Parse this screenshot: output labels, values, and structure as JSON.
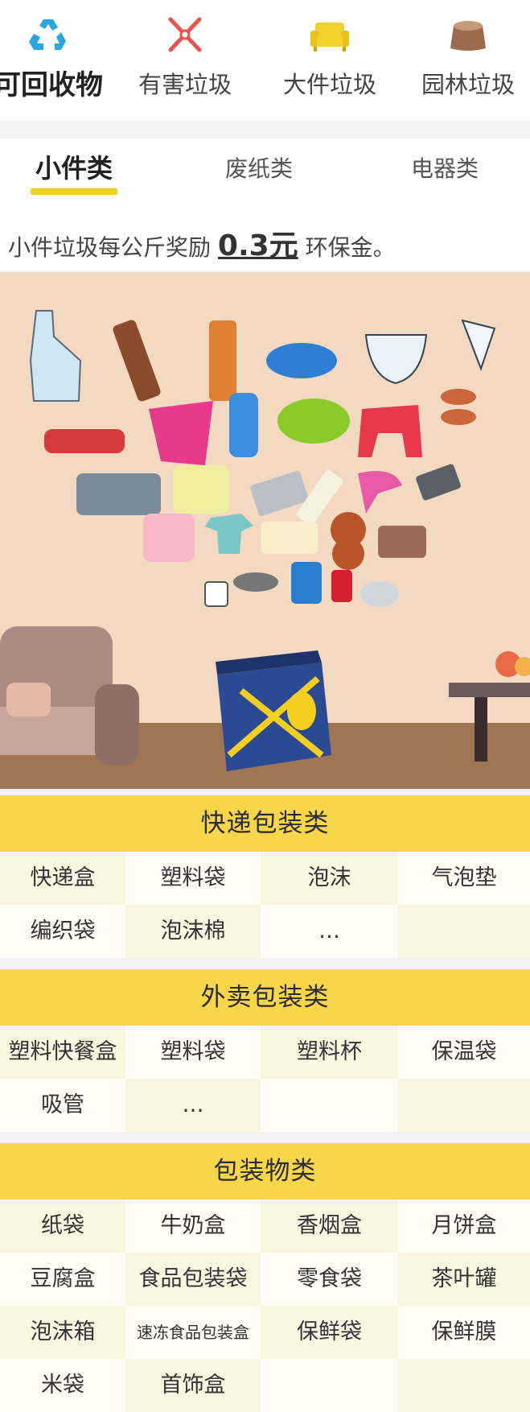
{
  "categories": [
    {
      "label": "可回收物",
      "icon": "recycle-icon",
      "color": "#2aa7e0"
    },
    {
      "label": "有害垃圾",
      "icon": "hazard-x-icon",
      "color": "#e8544e"
    },
    {
      "label": "大件垃圾",
      "icon": "sofa-icon",
      "color": "#f2d12a"
    },
    {
      "label": "园林垃圾",
      "icon": "tree-stump-icon",
      "color": "#9a6b4c"
    }
  ],
  "sub_tabs": [
    "小件类",
    "废纸类",
    "电器类"
  ],
  "reward": {
    "prefix": "小件垃圾每公斤奖励 ",
    "amount": "0.3元",
    "suffix": " 环保金。"
  },
  "sections": [
    {
      "title": "快递包装类",
      "items": [
        "快递盒",
        "塑料袋",
        "泡沫",
        "气泡垫",
        "编织袋",
        "泡沫棉",
        "…",
        ""
      ]
    },
    {
      "title": "外卖包装类",
      "items": [
        "塑料快餐盒",
        "塑料袋",
        "塑料杯",
        "保温袋",
        "吸管",
        "…",
        "",
        ""
      ]
    },
    {
      "title": "包装物类",
      "items": [
        "纸袋",
        "牛奶盒",
        "香烟盒",
        "月饼盒",
        "豆腐盒",
        "食品包装袋",
        "零食袋",
        "茶叶罐",
        "泡沫箱",
        "速冻食品包装盒",
        "保鲜袋",
        "保鲜膜",
        "米袋",
        "首饰盒",
        "",
        ""
      ]
    }
  ],
  "colors": {
    "accent": "#f5cf1e",
    "header": "#f8d64a",
    "cell_a": "#fbf6e2",
    "cell_b": "#fffdf3",
    "illustration_bg": "#f3d9bf"
  }
}
